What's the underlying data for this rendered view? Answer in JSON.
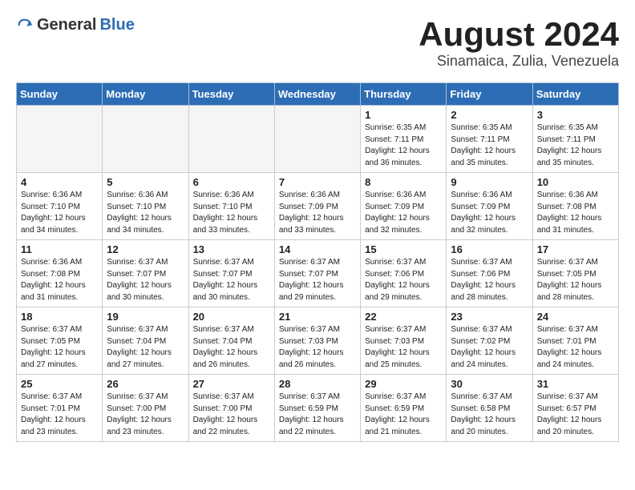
{
  "header": {
    "logo_general": "General",
    "logo_blue": "Blue",
    "month_title": "August 2024",
    "location": "Sinamaica, Zulia, Venezuela"
  },
  "days_of_week": [
    "Sunday",
    "Monday",
    "Tuesday",
    "Wednesday",
    "Thursday",
    "Friday",
    "Saturday"
  ],
  "weeks": [
    [
      {
        "day": "",
        "info": ""
      },
      {
        "day": "",
        "info": ""
      },
      {
        "day": "",
        "info": ""
      },
      {
        "day": "",
        "info": ""
      },
      {
        "day": "1",
        "info": "Sunrise: 6:35 AM\nSunset: 7:11 PM\nDaylight: 12 hours\nand 36 minutes."
      },
      {
        "day": "2",
        "info": "Sunrise: 6:35 AM\nSunset: 7:11 PM\nDaylight: 12 hours\nand 35 minutes."
      },
      {
        "day": "3",
        "info": "Sunrise: 6:35 AM\nSunset: 7:11 PM\nDaylight: 12 hours\nand 35 minutes."
      }
    ],
    [
      {
        "day": "4",
        "info": "Sunrise: 6:36 AM\nSunset: 7:10 PM\nDaylight: 12 hours\nand 34 minutes."
      },
      {
        "day": "5",
        "info": "Sunrise: 6:36 AM\nSunset: 7:10 PM\nDaylight: 12 hours\nand 34 minutes."
      },
      {
        "day": "6",
        "info": "Sunrise: 6:36 AM\nSunset: 7:10 PM\nDaylight: 12 hours\nand 33 minutes."
      },
      {
        "day": "7",
        "info": "Sunrise: 6:36 AM\nSunset: 7:09 PM\nDaylight: 12 hours\nand 33 minutes."
      },
      {
        "day": "8",
        "info": "Sunrise: 6:36 AM\nSunset: 7:09 PM\nDaylight: 12 hours\nand 32 minutes."
      },
      {
        "day": "9",
        "info": "Sunrise: 6:36 AM\nSunset: 7:09 PM\nDaylight: 12 hours\nand 32 minutes."
      },
      {
        "day": "10",
        "info": "Sunrise: 6:36 AM\nSunset: 7:08 PM\nDaylight: 12 hours\nand 31 minutes."
      }
    ],
    [
      {
        "day": "11",
        "info": "Sunrise: 6:36 AM\nSunset: 7:08 PM\nDaylight: 12 hours\nand 31 minutes."
      },
      {
        "day": "12",
        "info": "Sunrise: 6:37 AM\nSunset: 7:07 PM\nDaylight: 12 hours\nand 30 minutes."
      },
      {
        "day": "13",
        "info": "Sunrise: 6:37 AM\nSunset: 7:07 PM\nDaylight: 12 hours\nand 30 minutes."
      },
      {
        "day": "14",
        "info": "Sunrise: 6:37 AM\nSunset: 7:07 PM\nDaylight: 12 hours\nand 29 minutes."
      },
      {
        "day": "15",
        "info": "Sunrise: 6:37 AM\nSunset: 7:06 PM\nDaylight: 12 hours\nand 29 minutes."
      },
      {
        "day": "16",
        "info": "Sunrise: 6:37 AM\nSunset: 7:06 PM\nDaylight: 12 hours\nand 28 minutes."
      },
      {
        "day": "17",
        "info": "Sunrise: 6:37 AM\nSunset: 7:05 PM\nDaylight: 12 hours\nand 28 minutes."
      }
    ],
    [
      {
        "day": "18",
        "info": "Sunrise: 6:37 AM\nSunset: 7:05 PM\nDaylight: 12 hours\nand 27 minutes."
      },
      {
        "day": "19",
        "info": "Sunrise: 6:37 AM\nSunset: 7:04 PM\nDaylight: 12 hours\nand 27 minutes."
      },
      {
        "day": "20",
        "info": "Sunrise: 6:37 AM\nSunset: 7:04 PM\nDaylight: 12 hours\nand 26 minutes."
      },
      {
        "day": "21",
        "info": "Sunrise: 6:37 AM\nSunset: 7:03 PM\nDaylight: 12 hours\nand 26 minutes."
      },
      {
        "day": "22",
        "info": "Sunrise: 6:37 AM\nSunset: 7:03 PM\nDaylight: 12 hours\nand 25 minutes."
      },
      {
        "day": "23",
        "info": "Sunrise: 6:37 AM\nSunset: 7:02 PM\nDaylight: 12 hours\nand 24 minutes."
      },
      {
        "day": "24",
        "info": "Sunrise: 6:37 AM\nSunset: 7:01 PM\nDaylight: 12 hours\nand 24 minutes."
      }
    ],
    [
      {
        "day": "25",
        "info": "Sunrise: 6:37 AM\nSunset: 7:01 PM\nDaylight: 12 hours\nand 23 minutes."
      },
      {
        "day": "26",
        "info": "Sunrise: 6:37 AM\nSunset: 7:00 PM\nDaylight: 12 hours\nand 23 minutes."
      },
      {
        "day": "27",
        "info": "Sunrise: 6:37 AM\nSunset: 7:00 PM\nDaylight: 12 hours\nand 22 minutes."
      },
      {
        "day": "28",
        "info": "Sunrise: 6:37 AM\nSunset: 6:59 PM\nDaylight: 12 hours\nand 22 minutes."
      },
      {
        "day": "29",
        "info": "Sunrise: 6:37 AM\nSunset: 6:59 PM\nDaylight: 12 hours\nand 21 minutes."
      },
      {
        "day": "30",
        "info": "Sunrise: 6:37 AM\nSunset: 6:58 PM\nDaylight: 12 hours\nand 20 minutes."
      },
      {
        "day": "31",
        "info": "Sunrise: 6:37 AM\nSunset: 6:57 PM\nDaylight: 12 hours\nand 20 minutes."
      }
    ]
  ]
}
